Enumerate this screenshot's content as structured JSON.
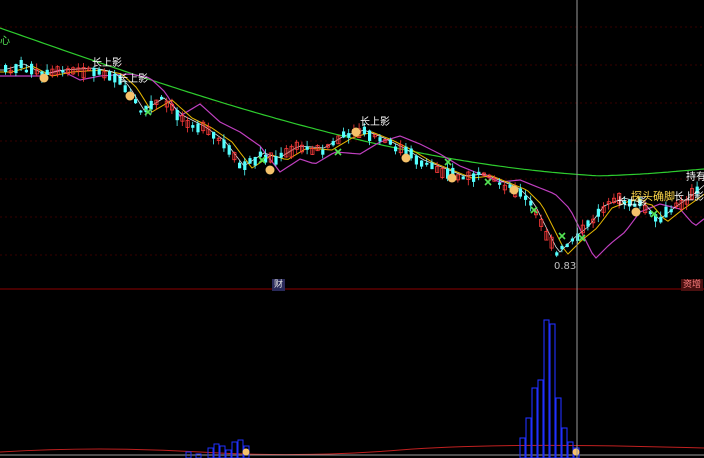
{
  "main_chart": {
    "corner_label": "心",
    "bottom_badge": "财",
    "right_badge": "资增",
    "low_price_label": "0.83",
    "annotations": [
      {
        "text": "长上影",
        "style": "white"
      },
      {
        "text": "长上影",
        "style": "white"
      },
      {
        "text": "长上影",
        "style": "white"
      },
      {
        "text": "长上影",
        "style": "white"
      },
      {
        "text": "长上影",
        "style": "white"
      },
      {
        "text": "探头确脚",
        "style": "yellow"
      },
      {
        "text": "持有",
        "style": "white"
      }
    ],
    "colors": {
      "up_candle": "#ff3b3b",
      "down_candle": "#54ffff",
      "ma_long": "#2ecc2e",
      "ma_mid": "#c040c0",
      "ma_short": "#e6b800",
      "ma_white": "#e0e0e0",
      "separator": "#8b0000",
      "cursor": "#9a9a9a",
      "grid": "#6e0000"
    }
  },
  "volume_chart": {
    "colors": {
      "bar": "#2030ff",
      "line_red": "#c02020",
      "line_white": "#d0d0d0"
    }
  }
}
